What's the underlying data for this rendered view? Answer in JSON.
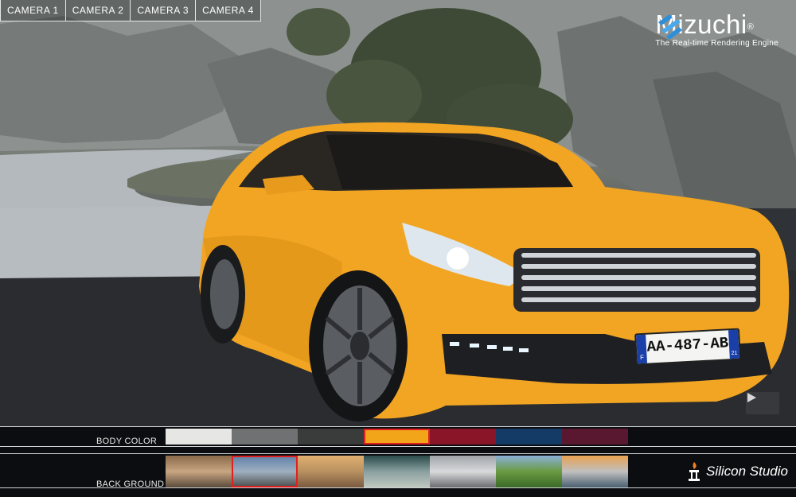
{
  "cameras": [
    "CAMERA 1",
    "CAMERA 2",
    "CAMERA 3",
    "CAMERA 4"
  ],
  "brand": {
    "name": "Mizuchi",
    "registered": "®",
    "tagline": "The Real-time Rendering Engine",
    "icon": "mizuchi-logo-icon"
  },
  "car": {
    "license_plate": "AA-487-AB",
    "plate_country": "F",
    "plate_region": "21"
  },
  "play_icon": "play-icon",
  "body_color": {
    "label": "BODY COLOR",
    "swatches": [
      {
        "name": "white",
        "color": "#e6e6e4"
      },
      {
        "name": "silver",
        "color": "#6f7172"
      },
      {
        "name": "dark-gray",
        "color": "#3a3b3b"
      },
      {
        "name": "orange",
        "color": "#f3a51a",
        "selected": true
      },
      {
        "name": "red",
        "color": "#8a1428"
      },
      {
        "name": "blue",
        "color": "#143a66"
      },
      {
        "name": "wine",
        "color": "#5a1830"
      }
    ]
  },
  "background": {
    "label": "BACK GROUND",
    "thumbnails": [
      {
        "name": "street",
        "colors": [
          "#8a6a4a",
          "#c9a682",
          "#5a4a3a"
        ]
      },
      {
        "name": "mountain-road",
        "colors": [
          "#5d7fa8",
          "#9fb0c0",
          "#4a4a48"
        ],
        "selected": true
      },
      {
        "name": "town-square",
        "colors": [
          "#e0b070",
          "#b89060",
          "#7a5a40"
        ]
      },
      {
        "name": "station",
        "colors": [
          "#2a4a4a",
          "#8aa0a0",
          "#c0c8c0"
        ]
      },
      {
        "name": "garage",
        "colors": [
          "#a0a4a8",
          "#d8dadc",
          "#6a6c70"
        ]
      },
      {
        "name": "park",
        "colors": [
          "#8ab0d8",
          "#6a9a40",
          "#3a6a28"
        ]
      },
      {
        "name": "seaside",
        "colors": [
          "#e8a050",
          "#c0c0c0",
          "#4a6070"
        ]
      }
    ]
  },
  "studio": {
    "name": "Silicon Studio",
    "icon": "silicon-studio-icon"
  }
}
